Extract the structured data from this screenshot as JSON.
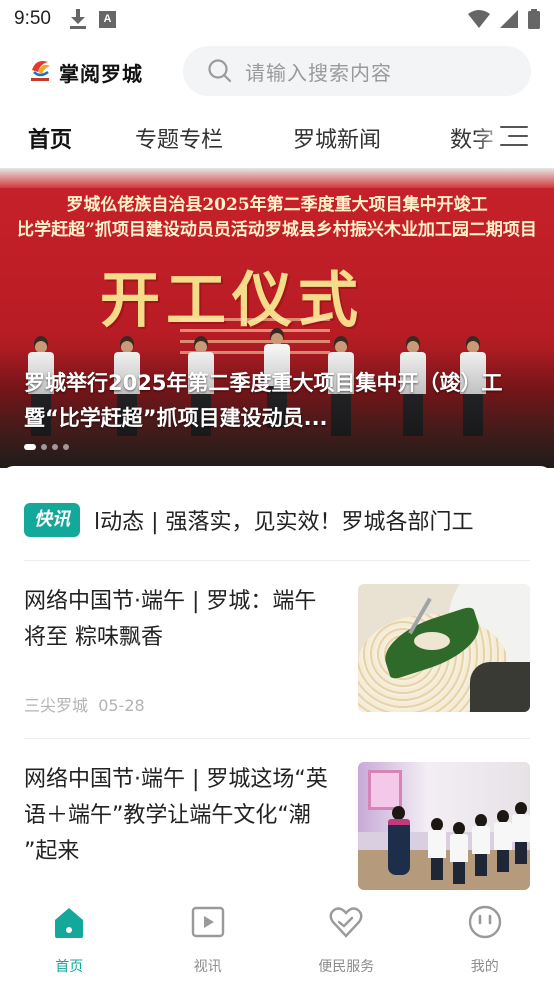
{
  "status_bar": {
    "time": "9:50"
  },
  "header": {
    "app_title": "掌阅罗城",
    "search_placeholder": "请输入搜索内容"
  },
  "tabs": [
    {
      "label": "首页",
      "active": true
    },
    {
      "label": "专题专栏",
      "active": false
    },
    {
      "label": "罗城新闻",
      "active": false
    },
    {
      "label": "数字",
      "active": false
    }
  ],
  "banner": {
    "headline_line1": "罗城仫佬族自治县2025年第二季度重大项目集中开竣工",
    "headline_line2": "比学赶超”抓项目建设动员员活动罗城县乡村振兴木业加工园二期项目",
    "big_text": "开工仪式",
    "caption": "罗城举行2025年第二季度重大项目集中开（竣）工暨“比学赶超”抓项目建设动员...",
    "slide_count": 4,
    "active_slide": 0
  },
  "ticker": {
    "badge": "快讯",
    "text": "l动态 | 强落实，见实效！罗城各部门工"
  },
  "news": [
    {
      "title": "网络中国节·端午 | 罗城：端午将至 粽味飘香",
      "source": "三尖罗城",
      "date": "05-28"
    },
    {
      "title": "网络中国节·端午 | 罗城这场“英语＋端午”教学让端午文化“潮 ”起来"
    }
  ],
  "bottom_nav": [
    {
      "label": "首页",
      "icon": "home-icon",
      "active": true
    },
    {
      "label": "视讯",
      "icon": "video-icon",
      "active": false
    },
    {
      "label": "便民服务",
      "icon": "heart-hand-icon",
      "active": false
    },
    {
      "label": "我的",
      "icon": "smiley-icon",
      "active": false
    }
  ],
  "colors": {
    "accent": "#14a89a",
    "banner_red": "#c8212b"
  }
}
